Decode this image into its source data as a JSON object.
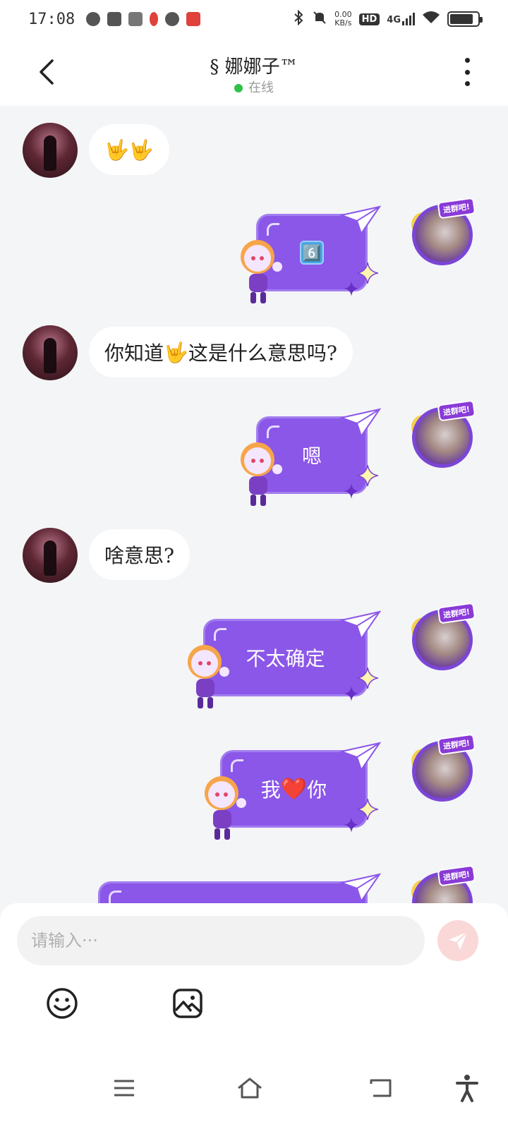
{
  "status_bar": {
    "time": "17:08",
    "net_speed_top": "0.00",
    "net_speed_bottom": "KB/s",
    "hd_label": "HD",
    "network_label": "4G",
    "left_icons": [
      "gear-icon",
      "play-icon",
      "document-icon",
      "location-pin-icon",
      "chat-bubble-icon",
      "app-badge-icon"
    ],
    "right_icons": [
      "bluetooth-icon",
      "mute-icon",
      "signal-icon",
      "wifi-icon",
      "battery-icon"
    ],
    "battery_level": 0.85
  },
  "header": {
    "title": "§ 娜娜子™",
    "status": "在线",
    "status_color": "#2ec24a"
  },
  "messages": [
    {
      "side": "left",
      "text": "🤟🤟"
    },
    {
      "side": "right",
      "text": "6️⃣"
    },
    {
      "side": "left",
      "text_before": "你知道",
      "emoji": "🤟",
      "text_after": "这是什么意思吗?"
    },
    {
      "side": "right",
      "text": "嗯"
    },
    {
      "side": "left",
      "text": "啥意思?"
    },
    {
      "side": "right",
      "text": "不太确定"
    },
    {
      "side": "right",
      "text_before": "我",
      "emoji": "❤️",
      "text_after": "你"
    },
    {
      "side": "right",
      "text": ""
    }
  ],
  "avatar_badge": "进群吧!",
  "composer": {
    "placeholder": "请输入···",
    "send_icon": "send-icon",
    "tools": [
      "emoji-icon",
      "image-icon"
    ]
  },
  "colors": {
    "bubble_right": "#8b57e8",
    "bubble_left": "#ffffff",
    "chat_bg": "#f4f5f7",
    "send_button": "#fbd8d8"
  },
  "nav": [
    "menu-icon",
    "home-icon",
    "back-nav-icon",
    "accessibility-icon"
  ]
}
